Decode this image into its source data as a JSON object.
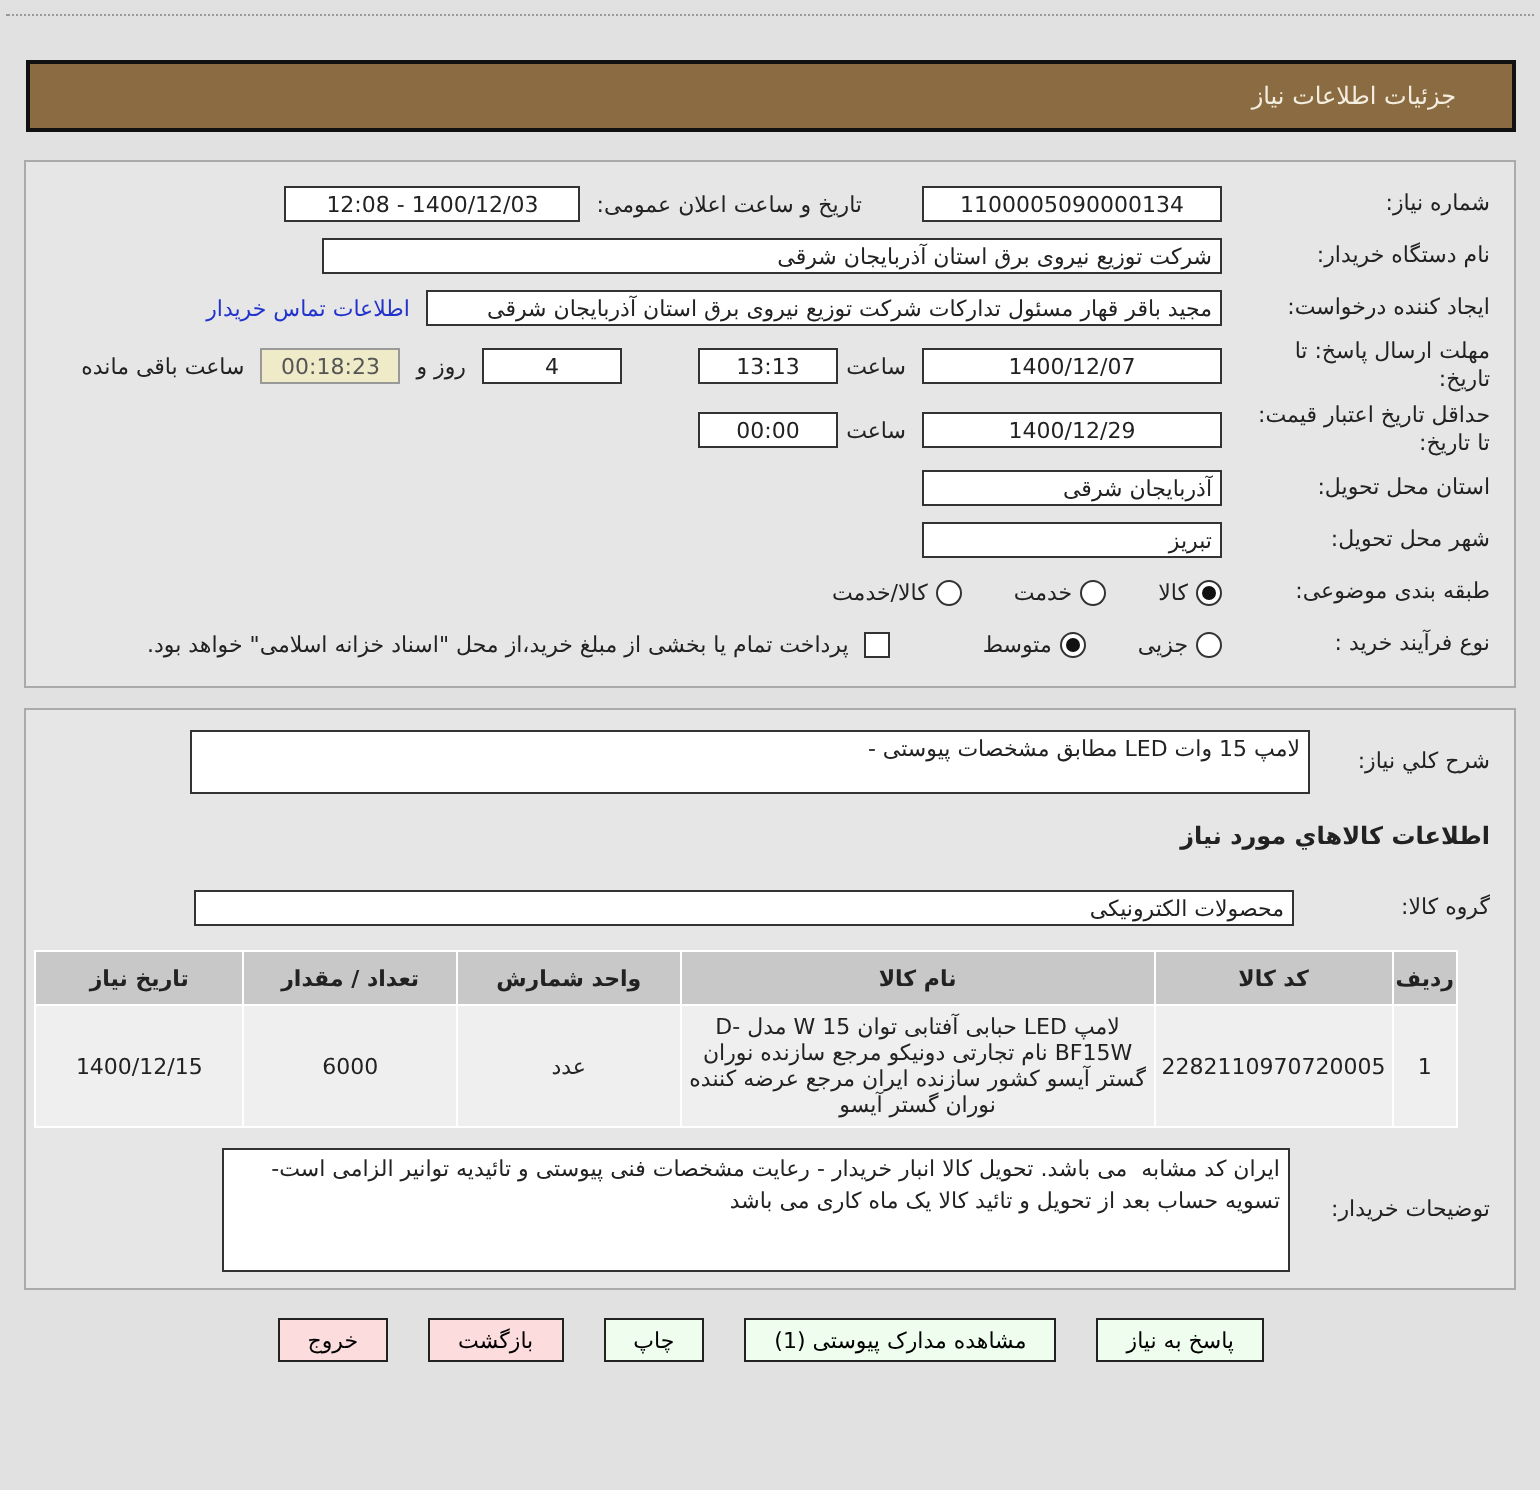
{
  "header": {
    "title": "جزئیات اطلاعات نیاز"
  },
  "need_info": {
    "need_number": {
      "label": "شماره نیاز:",
      "value": "1100005090000134"
    },
    "announce": {
      "label": "تاریخ و ساعت اعلان عمومی:",
      "value": "1400/12/03 - 12:08"
    },
    "buyer": {
      "label": "نام دستگاه خریدار:",
      "value": "شرکت توزیع نیروی برق استان آذربایجان شرقی"
    },
    "requester": {
      "label": "ایجاد کننده درخواست:",
      "value": "مجید باقر قهار مسئول تدارکات شرکت توزیع نیروی برق استان آذربایجان شرقی",
      "link": "اطلاعات تماس خریدار"
    },
    "deadline": {
      "label": "مهلت ارسال پاسخ: تا تاریخ:",
      "date": "1400/12/07",
      "time_label": "ساعت",
      "time": "13:13",
      "days": "4",
      "days_label": "روز و",
      "remaining": "00:18:23",
      "remaining_label": "ساعت باقی مانده"
    },
    "validity": {
      "label": "حداقل تاریخ اعتبار قیمت: تا تاریخ:",
      "date": "1400/12/29",
      "time_label": "ساعت",
      "time": "00:00"
    },
    "province": {
      "label": "استان محل تحویل:",
      "value": "آذربایجان شرقی"
    },
    "city": {
      "label": "شهر محل تحویل:",
      "value": "تبریز"
    },
    "category": {
      "label": "طبقه بندی موضوعی:",
      "options": [
        {
          "label": "کالا",
          "selected": true
        },
        {
          "label": "خدمت",
          "selected": false
        },
        {
          "label": "کالا/خدمت",
          "selected": false
        }
      ]
    },
    "process": {
      "label": "نوع فرآیند خرید :",
      "options": [
        {
          "label": "جزیی",
          "selected": false
        },
        {
          "label": "متوسط",
          "selected": true
        }
      ],
      "payment": {
        "label": "پرداخت تمام یا بخشی از مبلغ خرید،از محل \"اسناد خزانه اسلامی\" خواهد بود.",
        "checked": false
      }
    }
  },
  "goods": {
    "summary": {
      "label": "شرح کلي نياز:",
      "value": "لامپ 15 وات LED مطابق مشخصات پیوستی -"
    },
    "section_title": "اطلاعات کالاهاي مورد نياز",
    "group": {
      "label": "گروه کالا:",
      "value": "محصولات الکترونیکی"
    },
    "table": {
      "columns": [
        "ردیف",
        "کد کالا",
        "نام کالا",
        "واحد شمارش",
        "تعداد / مقدار",
        "تاریخ نیاز"
      ],
      "rows": [
        [
          "1",
          "2282110970720005",
          "لامپ LED حبابی آفتابی توان 15 W مدل D-BF15W نام تجارتی دونیکو مرجع سازنده نوران گستر آیسو کشور سازنده ایران مرجع عرضه کننده نوران گستر آیسو",
          "عدد",
          "6000",
          "1400/12/15"
        ]
      ]
    },
    "buyer_notes": {
      "label": "توضیحات خریدار:",
      "value": "ایران کد مشابه  می باشد. تحویل کالا انبار خریدار - رعایت مشخصات فنی پیوستی و تائیدیه توانیر الزامی است- تسویه حساب بعد از تحویل و تائید کالا یک ماه کاری می باشد"
    }
  },
  "buttons": [
    {
      "label": "پاسخ به نیاز",
      "kind": "primary"
    },
    {
      "label": "مشاهده مدارک پیوستی (1)",
      "kind": "primary"
    },
    {
      "label": "چاپ",
      "kind": "primary"
    },
    {
      "label": "بازگشت",
      "kind": "danger"
    },
    {
      "label": "خروج",
      "kind": "danger"
    }
  ]
}
